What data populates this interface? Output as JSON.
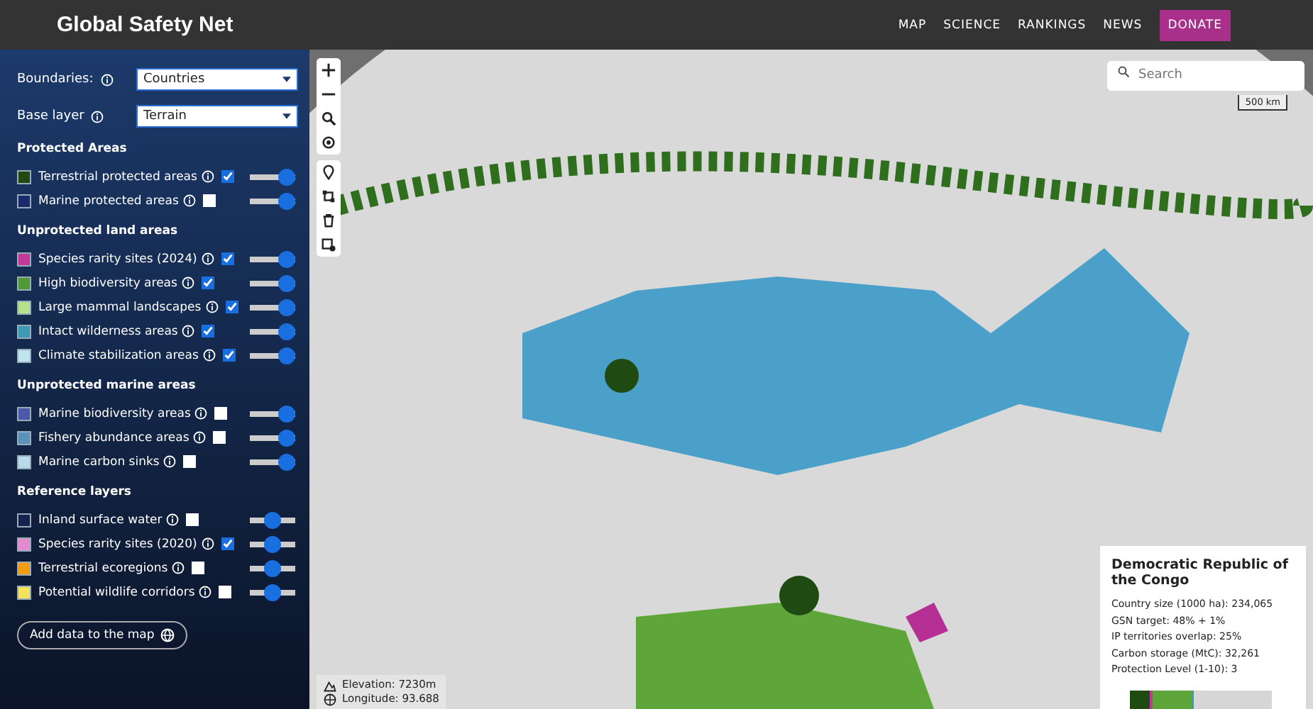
{
  "header": {
    "title": "Global Safety Net",
    "nav": [
      {
        "label": "MAP",
        "kind": "link"
      },
      {
        "label": "SCIENCE",
        "kind": "link"
      },
      {
        "label": "RANKINGS",
        "kind": "link"
      },
      {
        "label": "NEWS",
        "kind": "link"
      },
      {
        "label": "DONATE",
        "kind": "button"
      }
    ]
  },
  "sidebar": {
    "selects": [
      {
        "label": "Boundaries:",
        "value": "Countries"
      },
      {
        "label": "Base layer",
        "value": "Terrain"
      }
    ],
    "groups": [
      {
        "title": "Protected Areas",
        "layers": [
          {
            "name": "Terrestrial protected areas",
            "color": "#1f4a12",
            "checked": true,
            "level": 1
          },
          {
            "name": "Marine protected areas",
            "color": "#1a2a6a",
            "checked": false,
            "level": 1
          }
        ]
      },
      {
        "title": "Unprotected land areas",
        "layers": [
          {
            "name": "Species rarity sites (2024)",
            "color": "#c2399a",
            "checked": true,
            "level": 1
          },
          {
            "name": "High biodiversity areas",
            "color": "#4f9a36",
            "checked": true,
            "level": 1
          },
          {
            "name": "Large mammal landscapes",
            "color": "#b6e28a",
            "checked": true,
            "level": 1
          },
          {
            "name": "Intact wilderness areas",
            "color": "#3b9bb5",
            "checked": true,
            "level": 1
          },
          {
            "name": "Climate stabilization areas",
            "color": "#bfe3ef",
            "checked": true,
            "level": 1
          }
        ]
      },
      {
        "title": "Unprotected marine areas",
        "layers": [
          {
            "name": "Marine biodiversity areas",
            "color": "#4a5aa8",
            "checked": false,
            "level": 1
          },
          {
            "name": "Fishery abundance areas",
            "color": "#5b93b8",
            "checked": false,
            "level": 1
          },
          {
            "name": "Marine carbon sinks",
            "color": "#b7dbe8",
            "checked": false,
            "level": 1
          }
        ]
      },
      {
        "title": "Reference layers",
        "layers": [
          {
            "name": "Inland surface water",
            "color": "#14234f",
            "checked": false,
            "level": 0.5
          },
          {
            "name": "Species rarity sites (2020)",
            "color": "#e68ad0",
            "checked": true,
            "level": 0.5
          },
          {
            "name": "Terrestrial ecoregions",
            "color": "#f39c12",
            "checked": false,
            "level": 0.5
          },
          {
            "name": "Potential wildlife corridors",
            "color": "#f5e35a",
            "checked": false,
            "level": 0.5
          }
        ]
      }
    ],
    "add_button": "Add data to the map"
  },
  "map": {
    "search": {
      "placeholder": "Search"
    },
    "scale": "500 km",
    "tools": [
      [
        {
          "kind": "plus"
        },
        {
          "kind": "minus"
        },
        {
          "kind": "zoom"
        },
        {
          "kind": "locate"
        }
      ],
      [
        {
          "kind": "marker"
        },
        {
          "kind": "polygon"
        },
        {
          "kind": "trash"
        },
        {
          "kind": "layers"
        }
      ]
    ],
    "readout": [
      "Elevation: 7230m",
      "Longitude: 93.688"
    ],
    "info": {
      "title": "Democratic Republic of the Congo",
      "lines": [
        "Country size (1000 ha): 234,065",
        "GSN target: 48% + 1%",
        "IP territories overlap: 25%",
        "Carbon storage (MtC): 32,261",
        "Protection Level (1-10): 3"
      ]
    }
  }
}
